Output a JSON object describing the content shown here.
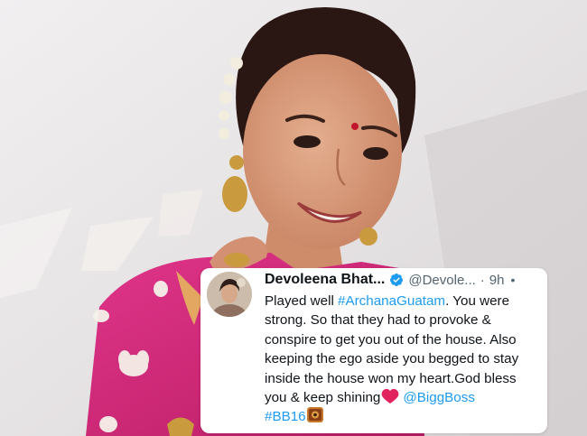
{
  "tweet": {
    "author_name": "Devoleena Bhat...",
    "handle": "@Devole...",
    "separator": "·",
    "time": "9h",
    "more": "•",
    "lines": [
      {
        "segments": [
          {
            "t": "Played well ",
            "link": false
          },
          {
            "t": "#ArchanaGuatam",
            "link": true
          },
          {
            "t": ". You were",
            "link": false
          }
        ]
      },
      {
        "segments": [
          {
            "t": "strong. So that they had to provoke &",
            "link": false
          }
        ]
      },
      {
        "segments": [
          {
            "t": "conspire to get you out of the house. Also",
            "link": false
          }
        ]
      },
      {
        "segments": [
          {
            "t": "keeping the ego aside you begged to stay",
            "link": false
          }
        ]
      },
      {
        "segments": [
          {
            "t": "inside the house won my heart.God bless",
            "link": false
          }
        ]
      }
    ],
    "line6_text": "you & keep shining",
    "mention": "@BiggBoss",
    "hashtag": "#BB16",
    "icons": [
      "verified-badge-icon",
      "heart-icon",
      "bigg-boss-emoji-icon"
    ]
  },
  "colors": {
    "link": "#1d9bf0",
    "heart": "#e0245e",
    "dress": "#d6287a",
    "background": "#e8e5e6"
  }
}
